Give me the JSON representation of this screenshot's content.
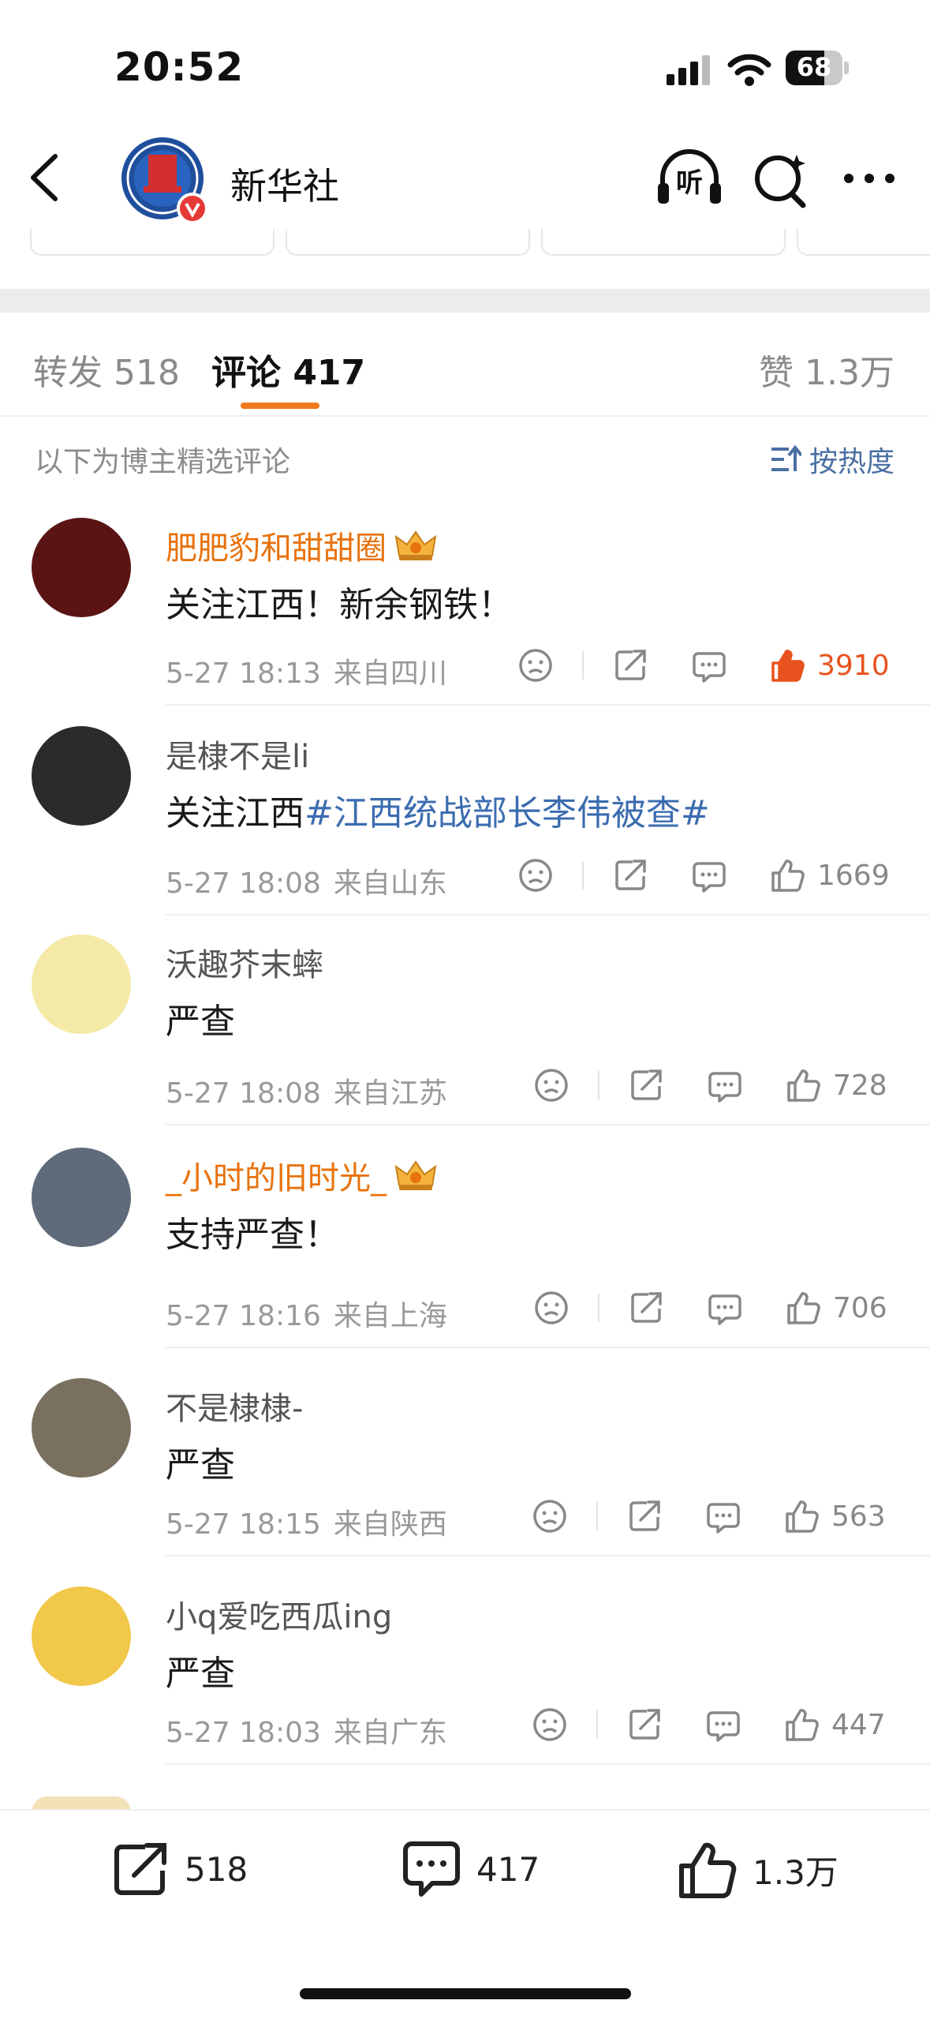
{
  "status": {
    "time": "20:52",
    "battery": "68"
  },
  "header": {
    "title": "新华社",
    "listen_label": "听"
  },
  "tabs": {
    "repost": "转发 518",
    "comments": "评论 417",
    "likes": "赞 1.3万"
  },
  "list": {
    "hint": "以下为博主精选评论",
    "sort": "按热度"
  },
  "comments": [
    {
      "user": "肥肥豹和甜甜圈",
      "text": "关注江西！新余钢铁！",
      "topic": "",
      "time": "5-27 18:13",
      "location": "来自四川",
      "likes": "3910",
      "liked": true,
      "vip": true
    },
    {
      "user": "是棣不是li",
      "text": "关注江西",
      "topic": "#江西统战部长李伟被查#",
      "time": "5-27 18:08",
      "location": "来自山东",
      "likes": "1669",
      "liked": false,
      "vip": false
    },
    {
      "user": "沃趣芥末蟀",
      "text": "严查",
      "topic": "",
      "time": "5-27 18:08",
      "location": "来自江苏",
      "likes": "728",
      "liked": false,
      "vip": false
    },
    {
      "user": "_小时的旧时光_",
      "text": "支持严查！",
      "topic": "",
      "time": "5-27 18:16",
      "location": "来自上海",
      "likes": "706",
      "liked": false,
      "vip": true
    },
    {
      "user": "不是棣棣-",
      "text": "严查",
      "topic": "",
      "time": "5-27 18:15",
      "location": "来自陕西",
      "likes": "563",
      "liked": false,
      "vip": false
    },
    {
      "user": "小q爱吃西瓜ing",
      "text": "严查",
      "topic": "",
      "time": "5-27 18:03",
      "location": "来自广东",
      "likes": "447",
      "liked": false,
      "vip": false
    }
  ],
  "bottom": {
    "repost": "518",
    "comment": "417",
    "like": "1.3万"
  },
  "colors": {
    "accent": "#f07a20",
    "vip_name": "#e8720c",
    "topic": "#3b6cb0",
    "liked": "#e8531f"
  }
}
